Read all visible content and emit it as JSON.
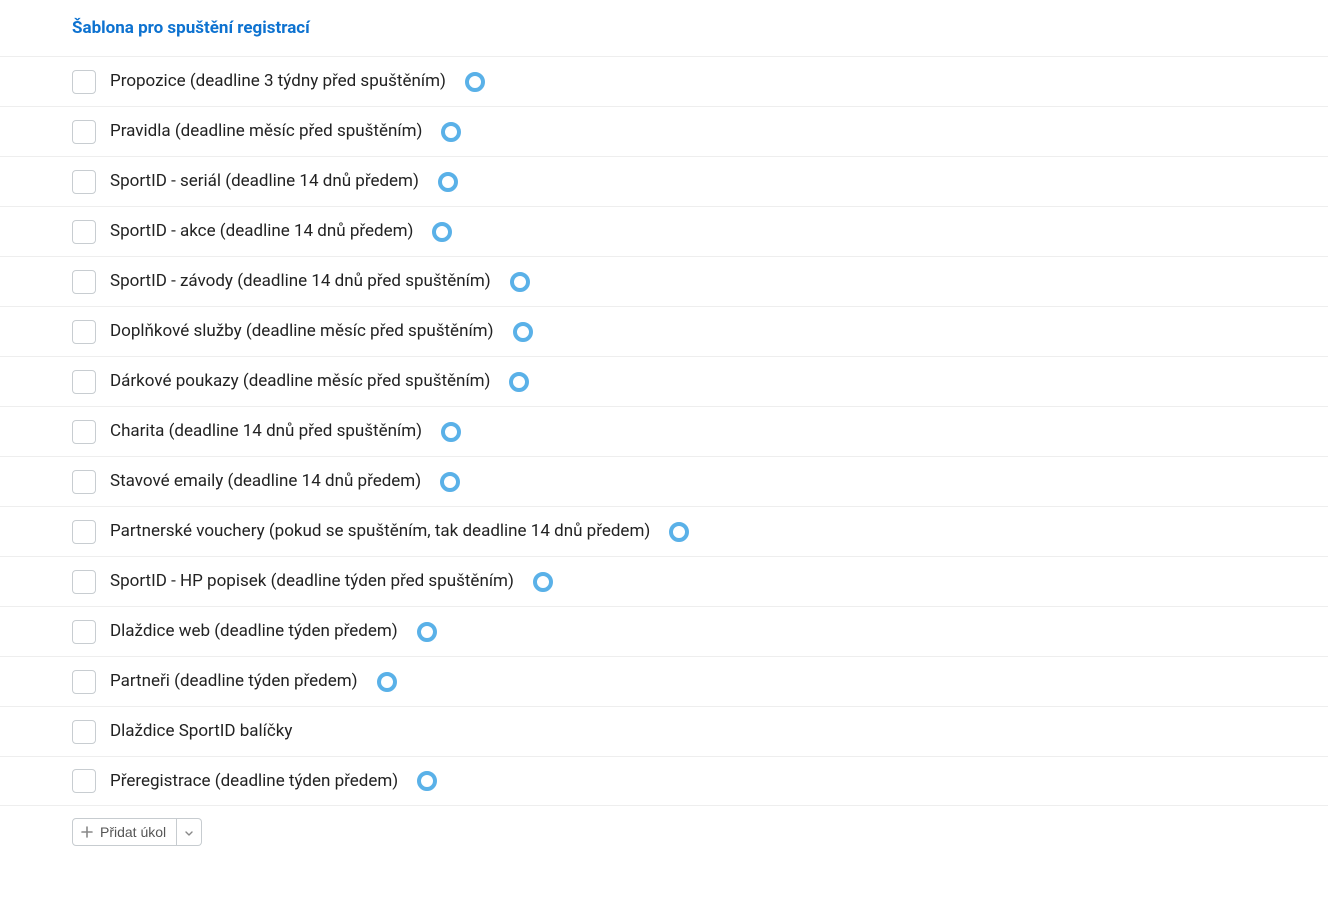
{
  "header": {
    "title": "Šablona pro spuštění registrací"
  },
  "tasks": [
    {
      "label": "Propozice (deadline 3 týdny před spuštěním)",
      "has_status": true
    },
    {
      "label": "Pravidla (deadline měsíc před spuštěním)",
      "has_status": true
    },
    {
      "label": "SportID - seriál (deadline 14 dnů předem)",
      "has_status": true
    },
    {
      "label": "SportID - akce (deadline 14 dnů předem)",
      "has_status": true
    },
    {
      "label": "SportID - závody (deadline 14 dnů před spuštěním)",
      "has_status": true
    },
    {
      "label": "Doplňkové služby (deadline měsíc před spuštěním)",
      "has_status": true
    },
    {
      "label": "Dárkové poukazy (deadline měsíc před spuštěním)",
      "has_status": true
    },
    {
      "label": "Charita (deadline 14 dnů před spuštěním)",
      "has_status": true
    },
    {
      "label": "Stavové emaily (deadline 14 dnů předem)",
      "has_status": true
    },
    {
      "label": "Partnerské vouchery (pokud se spuštěním, tak deadline 14 dnů předem)",
      "has_status": true
    },
    {
      "label": "SportID - HP popisek (deadline týden před spuštěním)",
      "has_status": true
    },
    {
      "label": "Dlaždice web (deadline týden předem)",
      "has_status": true
    },
    {
      "label": "Partneři (deadline týden předem)",
      "has_status": true
    },
    {
      "label": "Dlaždice SportID balíčky",
      "has_status": false
    },
    {
      "label": "Přeregistrace (deadline týden předem)",
      "has_status": true
    }
  ],
  "footer": {
    "add_label": "Přidat úkol"
  },
  "colors": {
    "accent": "#5ab1e8",
    "link": "#0d72d0"
  }
}
